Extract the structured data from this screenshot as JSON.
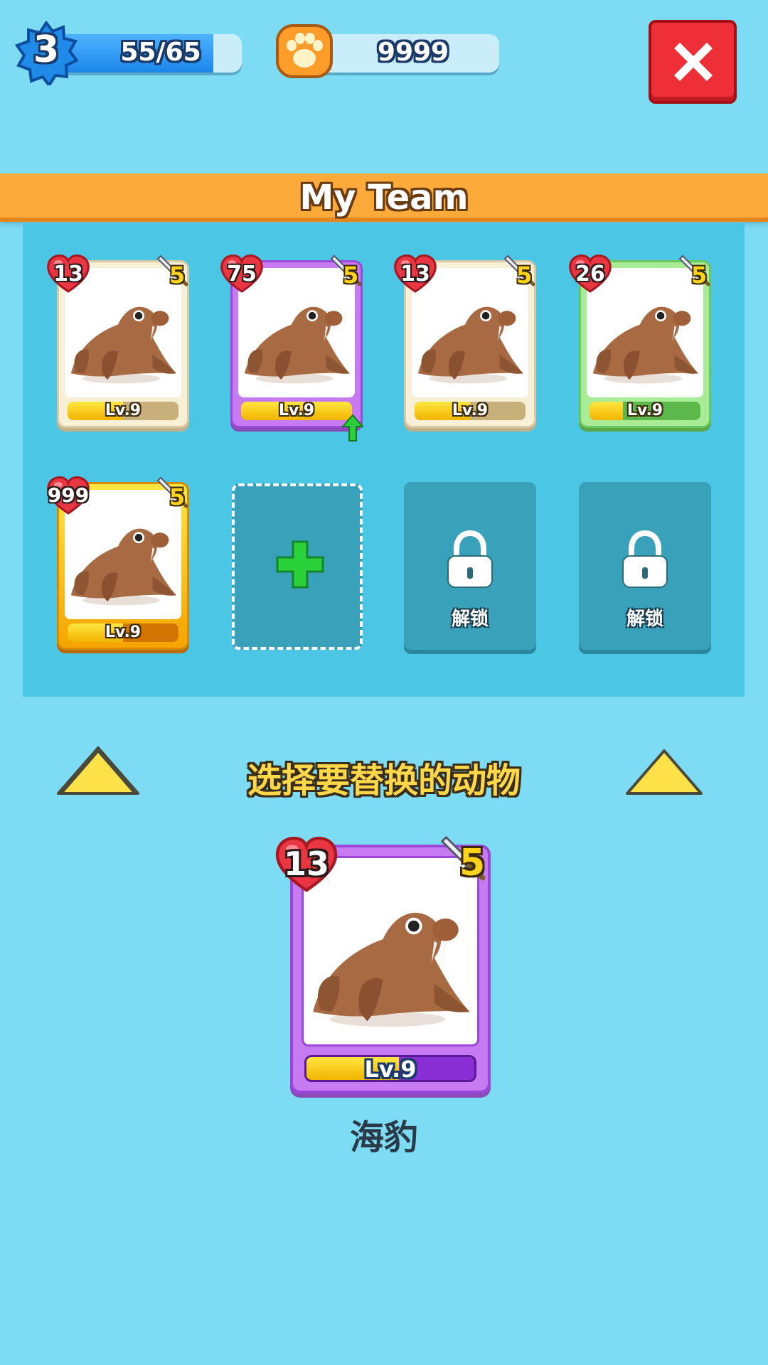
{
  "hud": {
    "level": "3",
    "xp_text": "55/65",
    "xp_progress": 0.85,
    "paws": "9999"
  },
  "banner": {
    "title": "My Team"
  },
  "team": [
    {
      "hp": "13",
      "atk": "5",
      "level": "Lv.9",
      "frame": "cream",
      "level_progress": 0.5
    },
    {
      "hp": "75",
      "atk": "5",
      "level": "Lv.9",
      "frame": "purple",
      "level_progress": 1.0,
      "upgrade": true
    },
    {
      "hp": "13",
      "atk": "5",
      "level": "Lv.9",
      "frame": "cream",
      "level_progress": 0.5
    },
    {
      "hp": "26",
      "atk": "5",
      "level": "Lv.9",
      "frame": "green",
      "level_progress": 0.3
    },
    {
      "hp": "999",
      "atk": "5",
      "level": "Lv.9",
      "frame": "gold",
      "level_progress": 0.5
    }
  ],
  "slots": {
    "locked_label": "解锁"
  },
  "selection": {
    "instruction": "选择要替换的动物",
    "card": {
      "hp": "13",
      "atk": "5",
      "level": "Lv.9",
      "level_progress": 0.55
    },
    "name": "海豹"
  },
  "colors": {
    "background": "#7ddcf4",
    "banner": "#fcab3a",
    "panel": "#4bc6e4",
    "close": "#ef2f37"
  }
}
